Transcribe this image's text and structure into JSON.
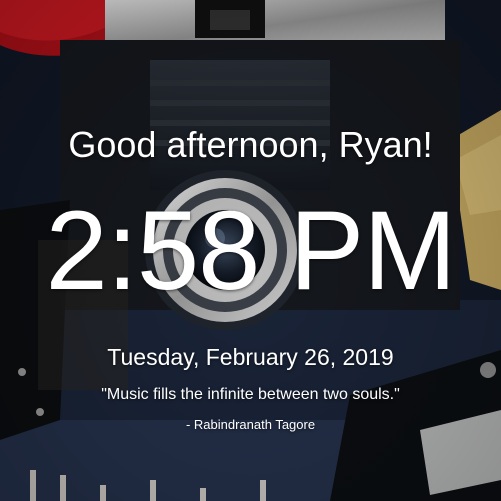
{
  "greeting": "Good afternoon, Ryan!",
  "clock": {
    "time": "2:58 PM"
  },
  "date": "Tuesday, February 26, 2019",
  "quote": {
    "text": "\"Music fills the infinite between two souls.\"",
    "author": "- Rabindranath Tagore"
  },
  "colors": {
    "text": "#ffffff",
    "accent_red": "#c8141c",
    "dark_blue": "#0d1420"
  }
}
